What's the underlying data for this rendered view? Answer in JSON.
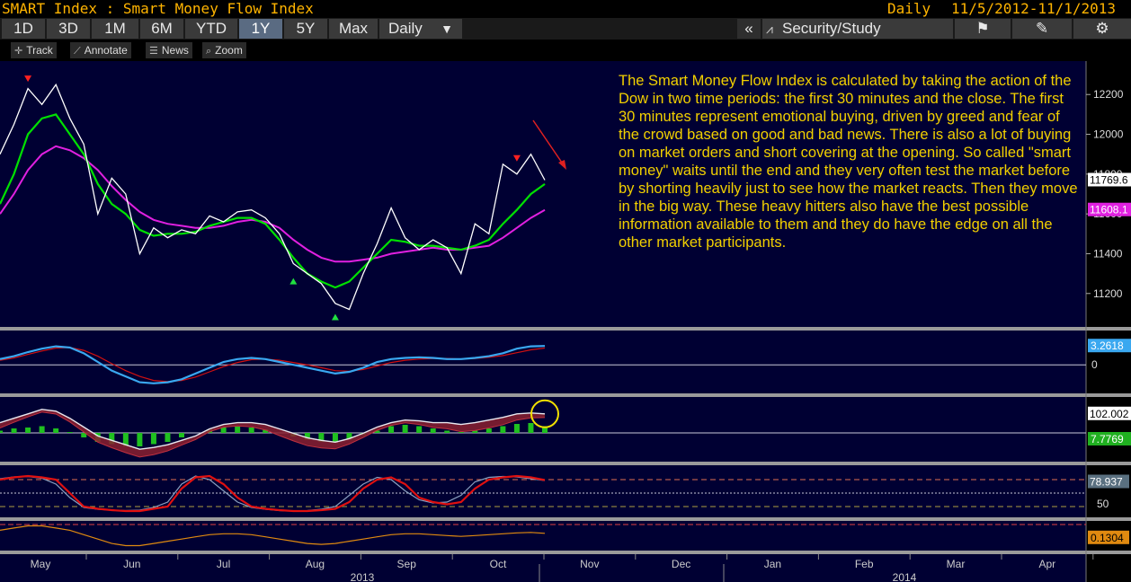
{
  "header": {
    "title": "SMART Index : Smart Money Flow Index",
    "periodicity": "Daily",
    "date_range": "11/5/2012-11/1/2013"
  },
  "toolbar": {
    "ranges": [
      "1D",
      "3D",
      "1M",
      "6M",
      "YTD",
      "1Y",
      "5Y",
      "Max"
    ],
    "active_range": "1Y",
    "freq_label": "Daily",
    "collapse_label": "«",
    "security_study_label": "Security/Study"
  },
  "subtoolbar": {
    "track": "Track",
    "annotate": "Annotate",
    "news": "News",
    "zoom": "Zoom"
  },
  "annotation_text": "The Smart Money Flow Index is calculated by taking the action of the Dow in two time periods: the first 30 minutes and the close. The first 30 minutes represent emotional buying, driven by greed and fear of the crowd based on good and bad news. There is also a lot of buying on market orders and short covering at the opening. So called \"smart money\" waits until the end and they very often test the market before by shorting heavily just to see how the market reacts. Then they move in the big way. These heavy hitters also have the best possible information available to them and they do have the edge on all the other market participants.",
  "colors": {
    "background": "#000033",
    "price": "#ffffff",
    "ma_fast": "#00e000",
    "ma_slow": "#e020e0",
    "macd": "#3aa8f0",
    "signal": "#d01010",
    "osc_bars": "#20c020",
    "stoch_k": "#e01010",
    "stoch_d": "#8aa0c0",
    "bottom_line": "#e08a10",
    "annotation": "#f2d000"
  },
  "chart_data": [
    {
      "type": "line",
      "panel": "price",
      "x": [
        "May",
        "Jun",
        "Jul",
        "Aug",
        "Sep",
        "Oct",
        "Nov",
        "Dec",
        "Jan",
        "Feb",
        "Mar",
        "Apr"
      ],
      "x_year_labels": [
        "2013",
        "2014"
      ],
      "ylim": [
        11050,
        12350
      ],
      "yticks": [
        11200,
        11400,
        11600,
        11800,
        12000,
        12200
      ],
      "series": [
        {
          "name": "",
          "values": [
            11900,
            12050,
            12230,
            12150,
            12250,
            12080,
            11950,
            11600,
            11780,
            11700,
            11400,
            11530,
            11480,
            11520,
            11500,
            11590,
            11560,
            11610,
            11620,
            11580,
            11500,
            11350,
            11300,
            11250,
            11150,
            11120,
            11300,
            11450,
            11630,
            11480,
            11420,
            11470,
            11430,
            11300,
            11550,
            11500,
            11850,
            11800,
            11900,
            11770
          ]
        },
        {
          "name": "",
          "values": [
            11650,
            11800,
            12000,
            12080,
            12100,
            12000,
            11900,
            11750,
            11650,
            11600,
            11520,
            11490,
            11500,
            11500,
            11510,
            11540,
            11560,
            11580,
            11580,
            11550,
            11470,
            11380,
            11300,
            11260,
            11230,
            11260,
            11330,
            11400,
            11470,
            11460,
            11440,
            11440,
            11430,
            11420,
            11440,
            11470,
            11550,
            11620,
            11700,
            11750
          ]
        },
        {
          "name": "",
          "values": [
            11600,
            11700,
            11820,
            11900,
            11940,
            11920,
            11880,
            11820,
            11740,
            11670,
            11610,
            11570,
            11550,
            11540,
            11530,
            11530,
            11540,
            11560,
            11570,
            11560,
            11530,
            11470,
            11420,
            11380,
            11360,
            11360,
            11370,
            11380,
            11400,
            11410,
            11420,
            11430,
            11420,
            11420,
            11430,
            11440,
            11480,
            11530,
            11580,
            11620
          ]
        }
      ],
      "markers": [
        {
          "type": "down",
          "x_index": 2,
          "value": 12250
        },
        {
          "type": "up",
          "x_index": 21,
          "value": 11300
        },
        {
          "type": "up",
          "x_index": 24,
          "value": 11120
        },
        {
          "type": "down",
          "x_index": 37,
          "value": 11850
        }
      ],
      "last_labels": [
        "11769.6",
        "11608.1"
      ]
    },
    {
      "type": "line",
      "panel": "macd",
      "ylim": [
        -4,
        5
      ],
      "yticks": [
        0
      ],
      "series": [
        {
          "name": "",
          "values": [
            1,
            1.5,
            2.2,
            2.8,
            3.2,
            3.0,
            2.0,
            0.5,
            -1.0,
            -2.0,
            -3.0,
            -3.2,
            -3.0,
            -2.5,
            -1.5,
            -0.5,
            0.5,
            1.0,
            1.2,
            1.0,
            0.5,
            0,
            -0.5,
            -1.0,
            -1.5,
            -1.2,
            -0.5,
            0.5,
            1.0,
            1.2,
            1.3,
            1.2,
            1.0,
            1.0,
            1.2,
            1.5,
            2.0,
            2.8,
            3.2,
            3.26
          ]
        },
        {
          "name": "",
          "values": [
            0.8,
            1.2,
            1.8,
            2.4,
            2.9,
            3.0,
            2.5,
            1.5,
            0.2,
            -1.0,
            -2.0,
            -2.7,
            -2.9,
            -2.7,
            -2.1,
            -1.2,
            -0.3,
            0.4,
            0.9,
            1.0,
            0.8,
            0.4,
            0,
            -0.5,
            -1.0,
            -1.1,
            -0.8,
            -0.2,
            0.4,
            0.8,
            1.0,
            1.1,
            1.1,
            1.0,
            1.1,
            1.3,
            1.6,
            2.1,
            2.6,
            2.9
          ]
        }
      ],
      "last_labels": [
        "3.2618",
        "0"
      ]
    },
    {
      "type": "area",
      "panel": "oscillator",
      "series": [
        {
          "name": "",
          "values": [
            101,
            101.5,
            102,
            102.5,
            102.3,
            101.5,
            100.5,
            99.5,
            99,
            98.5,
            98,
            98.2,
            98.5,
            99,
            99.5,
            100.3,
            100.8,
            101,
            101,
            100.8,
            100.3,
            99.8,
            99.3,
            99,
            98.8,
            99.2,
            99.8,
            100.5,
            101,
            101.3,
            101.2,
            101,
            101,
            100.8,
            101,
            101.3,
            101.6,
            102,
            102.1,
            102.0
          ]
        },
        {
          "name": "",
          "values": [
            0.5,
            1,
            1.2,
            1.5,
            1,
            0.2,
            -1,
            -2,
            -2.5,
            -3,
            -3,
            -2.5,
            -2,
            -1,
            0,
            0.8,
            1.2,
            1.4,
            1.2,
            0.8,
            0,
            -0.8,
            -1.5,
            -2,
            -2.2,
            -1.5,
            -0.5,
            0.5,
            1.5,
            1.8,
            1.5,
            1,
            0.5,
            0.2,
            0.5,
            1,
            1.5,
            2,
            2.2,
            1.5
          ]
        }
      ],
      "last_labels": [
        "102.002",
        "7.7769"
      ]
    },
    {
      "type": "line",
      "panel": "stochastic",
      "ylim": [
        0,
        100
      ],
      "yticks": [
        50
      ],
      "series": [
        {
          "name": "",
          "values": [
            80,
            85,
            88,
            85,
            80,
            50,
            20,
            15,
            12,
            10,
            10,
            15,
            20,
            60,
            85,
            88,
            70,
            40,
            20,
            15,
            12,
            10,
            10,
            12,
            15,
            30,
            60,
            80,
            85,
            70,
            40,
            30,
            25,
            30,
            60,
            80,
            85,
            88,
            85,
            79
          ]
        },
        {
          "name": "",
          "values": [
            82,
            86,
            87,
            83,
            70,
            40,
            18,
            14,
            12,
            11,
            12,
            18,
            30,
            70,
            88,
            80,
            55,
            30,
            18,
            14,
            11,
            10,
            11,
            14,
            20,
            45,
            70,
            85,
            80,
            55,
            35,
            28,
            30,
            45,
            75,
            85,
            87,
            86,
            82,
            78
          ]
        }
      ],
      "last_labels": [
        "78.937",
        "50"
      ]
    },
    {
      "type": "line",
      "panel": "bottom",
      "series": [
        {
          "name": "",
          "values": [
            0.2,
            0.25,
            0.3,
            0.3,
            0.25,
            0.2,
            0.1,
            0,
            -0.1,
            -0.15,
            -0.15,
            -0.1,
            -0.05,
            0,
            0.05,
            0.1,
            0.12,
            0.12,
            0.1,
            0.05,
            0,
            -0.05,
            -0.1,
            -0.12,
            -0.1,
            -0.05,
            0,
            0.05,
            0.1,
            0.12,
            0.12,
            0.1,
            0.08,
            0.06,
            0.08,
            0.1,
            0.12,
            0.14,
            0.15,
            0.13
          ]
        }
      ],
      "last_labels": [
        "0.1304"
      ]
    }
  ]
}
